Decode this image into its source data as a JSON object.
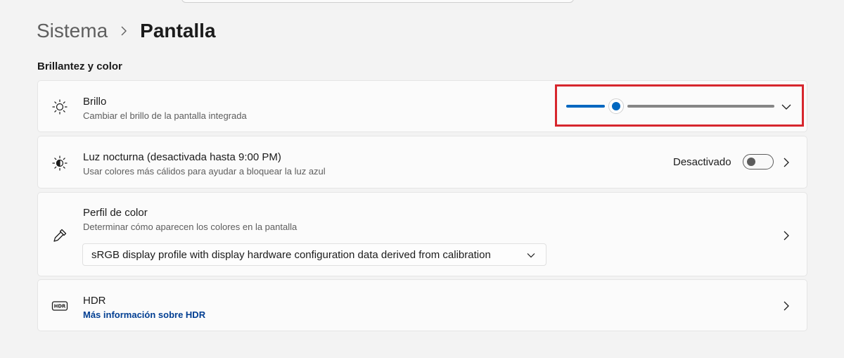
{
  "breadcrumb": {
    "parent": "Sistema",
    "current": "Pantalla"
  },
  "section": {
    "title": "Brillantez y color"
  },
  "brillo": {
    "title": "Brillo",
    "subtitle": "Cambiar el brillo de la pantalla integrada",
    "value_fraction": 0.22,
    "icon": "sun-icon"
  },
  "luz_nocturna": {
    "title": "Luz nocturna (desactivada hasta 9:00 PM)",
    "subtitle": "Usar colores más cálidos para ayudar a bloquear la luz azul",
    "toggle_label": "Desactivado",
    "toggle_on": false,
    "icon": "night-light-icon"
  },
  "perfil_color": {
    "title": "Perfil de color",
    "subtitle": "Determinar cómo aparecen los colores en la pantalla",
    "selected_profile": "sRGB display profile with display hardware configuration data derived from calibration",
    "icon": "eyedropper-icon"
  },
  "hdr": {
    "title": "HDR",
    "link": "Más información sobre HDR",
    "icon": "hdr-icon"
  },
  "colors": {
    "accent": "#0067c0",
    "highlight_border": "#d7262d",
    "link": "#003e92"
  }
}
